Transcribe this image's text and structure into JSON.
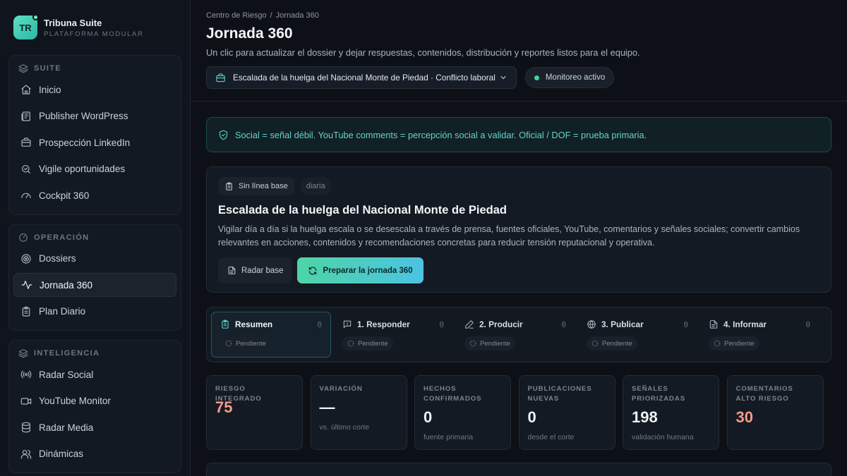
{
  "brand": {
    "initials": "TR",
    "name": "Tribuna Suite",
    "subtitle": "PLATAFORMA MODULAR"
  },
  "sidebar": {
    "groups": [
      {
        "title": "SUITE",
        "icon": "layers-icon",
        "items": [
          {
            "label": "Inicio",
            "icon": "home-icon"
          },
          {
            "label": "Publisher WordPress",
            "icon": "newspaper-icon"
          },
          {
            "label": "Prospección LinkedIn",
            "icon": "briefcase-icon"
          },
          {
            "label": "Vigile oportunidades",
            "icon": "search-icon"
          },
          {
            "label": "Cockpit 360",
            "icon": "gauge-icon"
          }
        ]
      },
      {
        "title": "OPERACIÓN",
        "icon": "gauge-icon",
        "items": [
          {
            "label": "Dossiers",
            "icon": "target-icon"
          },
          {
            "label": "Jornada 360",
            "icon": "activity-icon",
            "active": true
          },
          {
            "label": "Plan Diario",
            "icon": "clipboard-icon"
          }
        ]
      },
      {
        "title": "INTELIGENCIA",
        "icon": "layers-icon",
        "items": [
          {
            "label": "Radar Social",
            "icon": "radio-icon"
          },
          {
            "label": "YouTube Monitor",
            "icon": "video-icon"
          },
          {
            "label": "Radar Media",
            "icon": "database-icon"
          },
          {
            "label": "Dinámicas",
            "icon": "users-icon"
          }
        ]
      }
    ]
  },
  "header": {
    "breadcrumb": [
      "Centro de Riesgo",
      "Jornada 360"
    ],
    "breadcrumb_separator": "/",
    "title": "Jornada 360",
    "subtitle": "Un clic para actualizar el dossier y dejar respuestas, contenidos, distribución y reportes listos para el equipo.",
    "case_select": "Escalada de la huelga del Nacional Monte de Piedad · Conflicto laboral",
    "status": "Monitoreo activo"
  },
  "notice": "Social = señal débil. YouTube comments = percepción social a validar. Oficial / DOF = prueba primaria.",
  "case": {
    "tag_baseline": "Sin línea base",
    "tag_frequency": "diaria",
    "title": "Escalada de la huelga del Nacional Monte de Piedad",
    "description": "Vigilar día a día si la huelga escala o se desescala a través de prensa, fuentes oficiales, YouTube, comentarios y señales sociales; convertir cambios relevantes en acciones, contenidos y recomendaciones concretas para reducir tensión reputacional y operativa.",
    "btn_radar": "Radar base",
    "btn_prepare": "Preparar la jornada 360"
  },
  "steps": [
    {
      "label": "Resumen",
      "count": "0",
      "status": "Pendiente",
      "icon": "clipboard-icon",
      "active": true
    },
    {
      "label": "1. Responder",
      "count": "0",
      "status": "Pendiente",
      "icon": "message-icon"
    },
    {
      "label": "2. Producir",
      "count": "0",
      "status": "Pendiente",
      "icon": "pen-icon"
    },
    {
      "label": "3. Publicar",
      "count": "0",
      "status": "Pendiente",
      "icon": "globe-icon"
    },
    {
      "label": "4. Informar",
      "count": "0",
      "status": "Pendiente",
      "icon": "file-icon"
    }
  ],
  "kpis": [
    {
      "label": "RIESGO INTEGRADO",
      "value": "75",
      "sub": ""
    },
    {
      "label": "VARIACIÓN",
      "value": "—",
      "sub": "vs. último corte"
    },
    {
      "label": "HECHOS CONFIRMADOS",
      "value": "0",
      "sub": "fuente primaria"
    },
    {
      "label": "PUBLICACIONES NUEVAS",
      "value": "0",
      "sub": "desde el corte"
    },
    {
      "label": "SEÑALES PRIORIZADAS",
      "value": "198",
      "sub": "validación humana"
    },
    {
      "label": "COMENTARIOS ALTO RIESGO",
      "value": "30",
      "sub": ""
    }
  ],
  "colors": {
    "accent": "#4fd4a5",
    "accent_alt": "#4cc3e2",
    "risk": "#f59a8a",
    "notice_text": "#63d3c9",
    "status_dot": "#3dd59b"
  }
}
